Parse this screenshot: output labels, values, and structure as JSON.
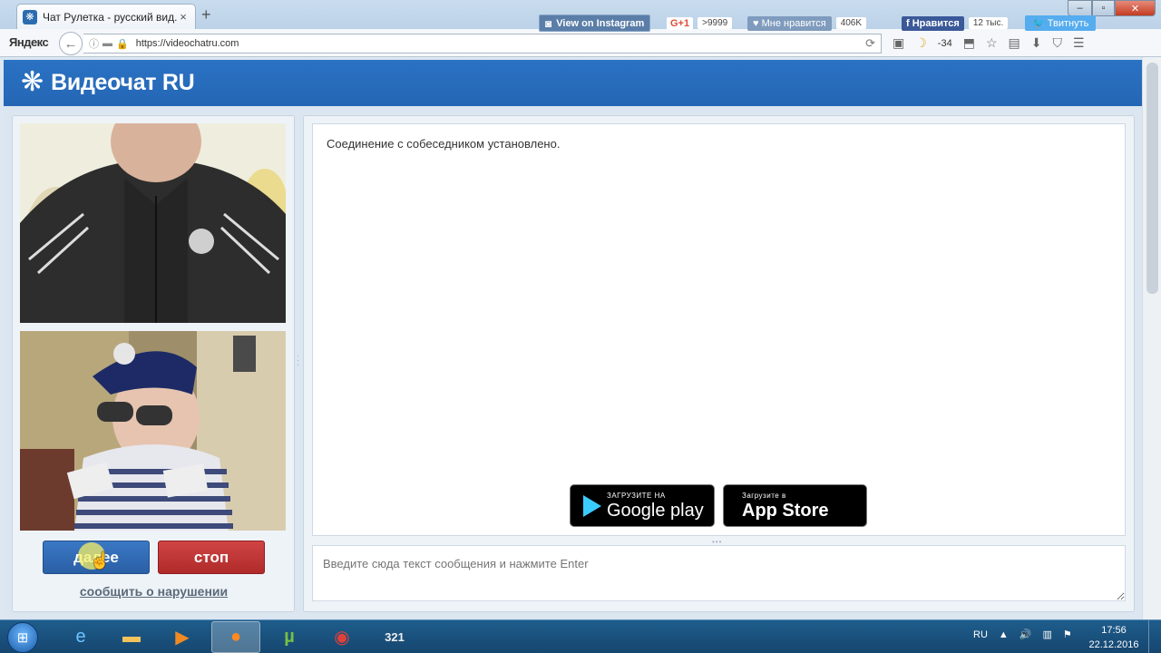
{
  "browser": {
    "tab_title": "Чат Рулетка - русский вид...",
    "tab_close": "×",
    "new_tab": "+",
    "brand": "Яндекс",
    "url": "https://videochatru.com",
    "weather_temp": "-34",
    "window_controls": [
      "–",
      "▫",
      "✕"
    ]
  },
  "site": {
    "logo": "Видеочат RU",
    "instagram_label": "View on Instagram",
    "gplus_label": "G+1",
    "gplus_count": ">9999",
    "vk_label": "Мне нравится",
    "vk_count": "406K",
    "fb_label": "Нравится",
    "fb_count": "12 тыс.",
    "tw_label": "Твитнуть"
  },
  "controls": {
    "next_label": "далее",
    "stop_label": "стоп",
    "report_label": "сообщить о нарушении"
  },
  "chat": {
    "status_message": "Соединение с собеседником установлено.",
    "input_placeholder": "Введите сюда текст сообщения и нажмите Enter",
    "google_play_small": "ЗАГРУЗИТЕ НА",
    "google_play_big": "Google play",
    "app_store_small": "Загрузите в",
    "app_store_big": "App Store"
  },
  "taskbar": {
    "language": "RU",
    "time": "17:56",
    "date": "22.12.2016"
  },
  "colors": {
    "header_blue": "#2466b4",
    "next_button": "#2a5fa6",
    "stop_button": "#b02a2a"
  }
}
